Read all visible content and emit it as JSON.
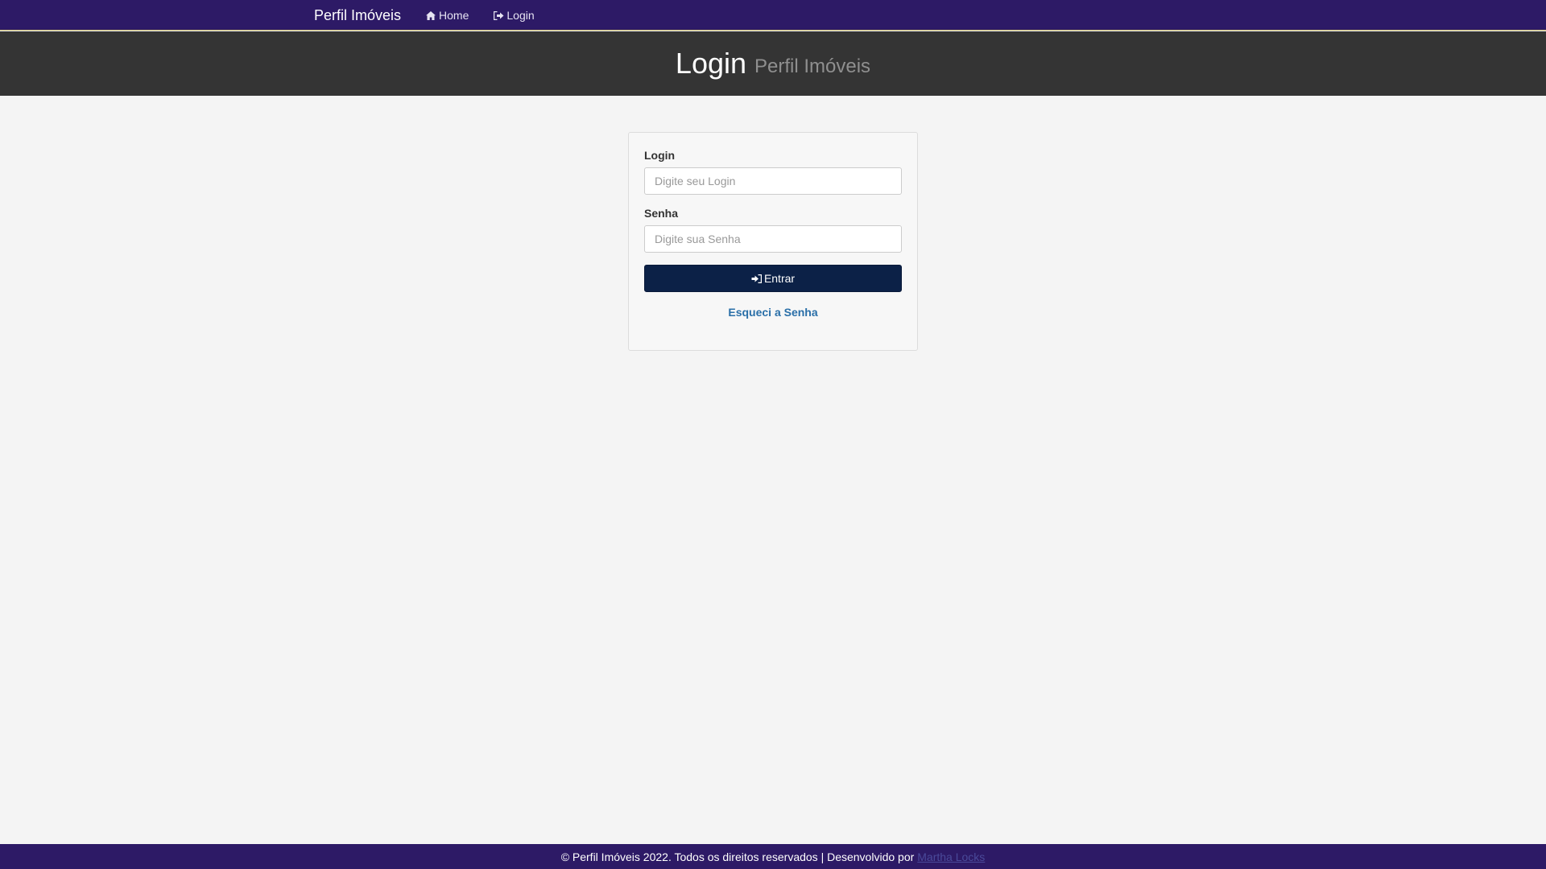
{
  "navbar": {
    "brand": "Perfil Imóveis",
    "links": [
      {
        "label": "Home",
        "icon": "home-icon"
      },
      {
        "label": "Login",
        "icon": "sign-out-icon"
      }
    ]
  },
  "header": {
    "title": "Login",
    "subtitle": "Perfil Imóveis"
  },
  "form": {
    "login_label": "Login",
    "login_placeholder": "Digite seu Login",
    "password_label": "Senha",
    "password_placeholder": "Digite sua Senha",
    "submit_label": "Entrar",
    "submit_icon": "sign-in-icon",
    "forgot_label": "Esqueci a Senha"
  },
  "footer": {
    "text": "© Perfil Imóveis 2022. Todos os direitos reservados | Desenvolvido por",
    "developer": "Martha Locks"
  },
  "colors": {
    "navbar_bg": "#2d1a66",
    "header_bg": "#343434",
    "button_bg": "#0c2147",
    "link": "#2a6fa8",
    "page_bg": "#f4f4f4"
  }
}
